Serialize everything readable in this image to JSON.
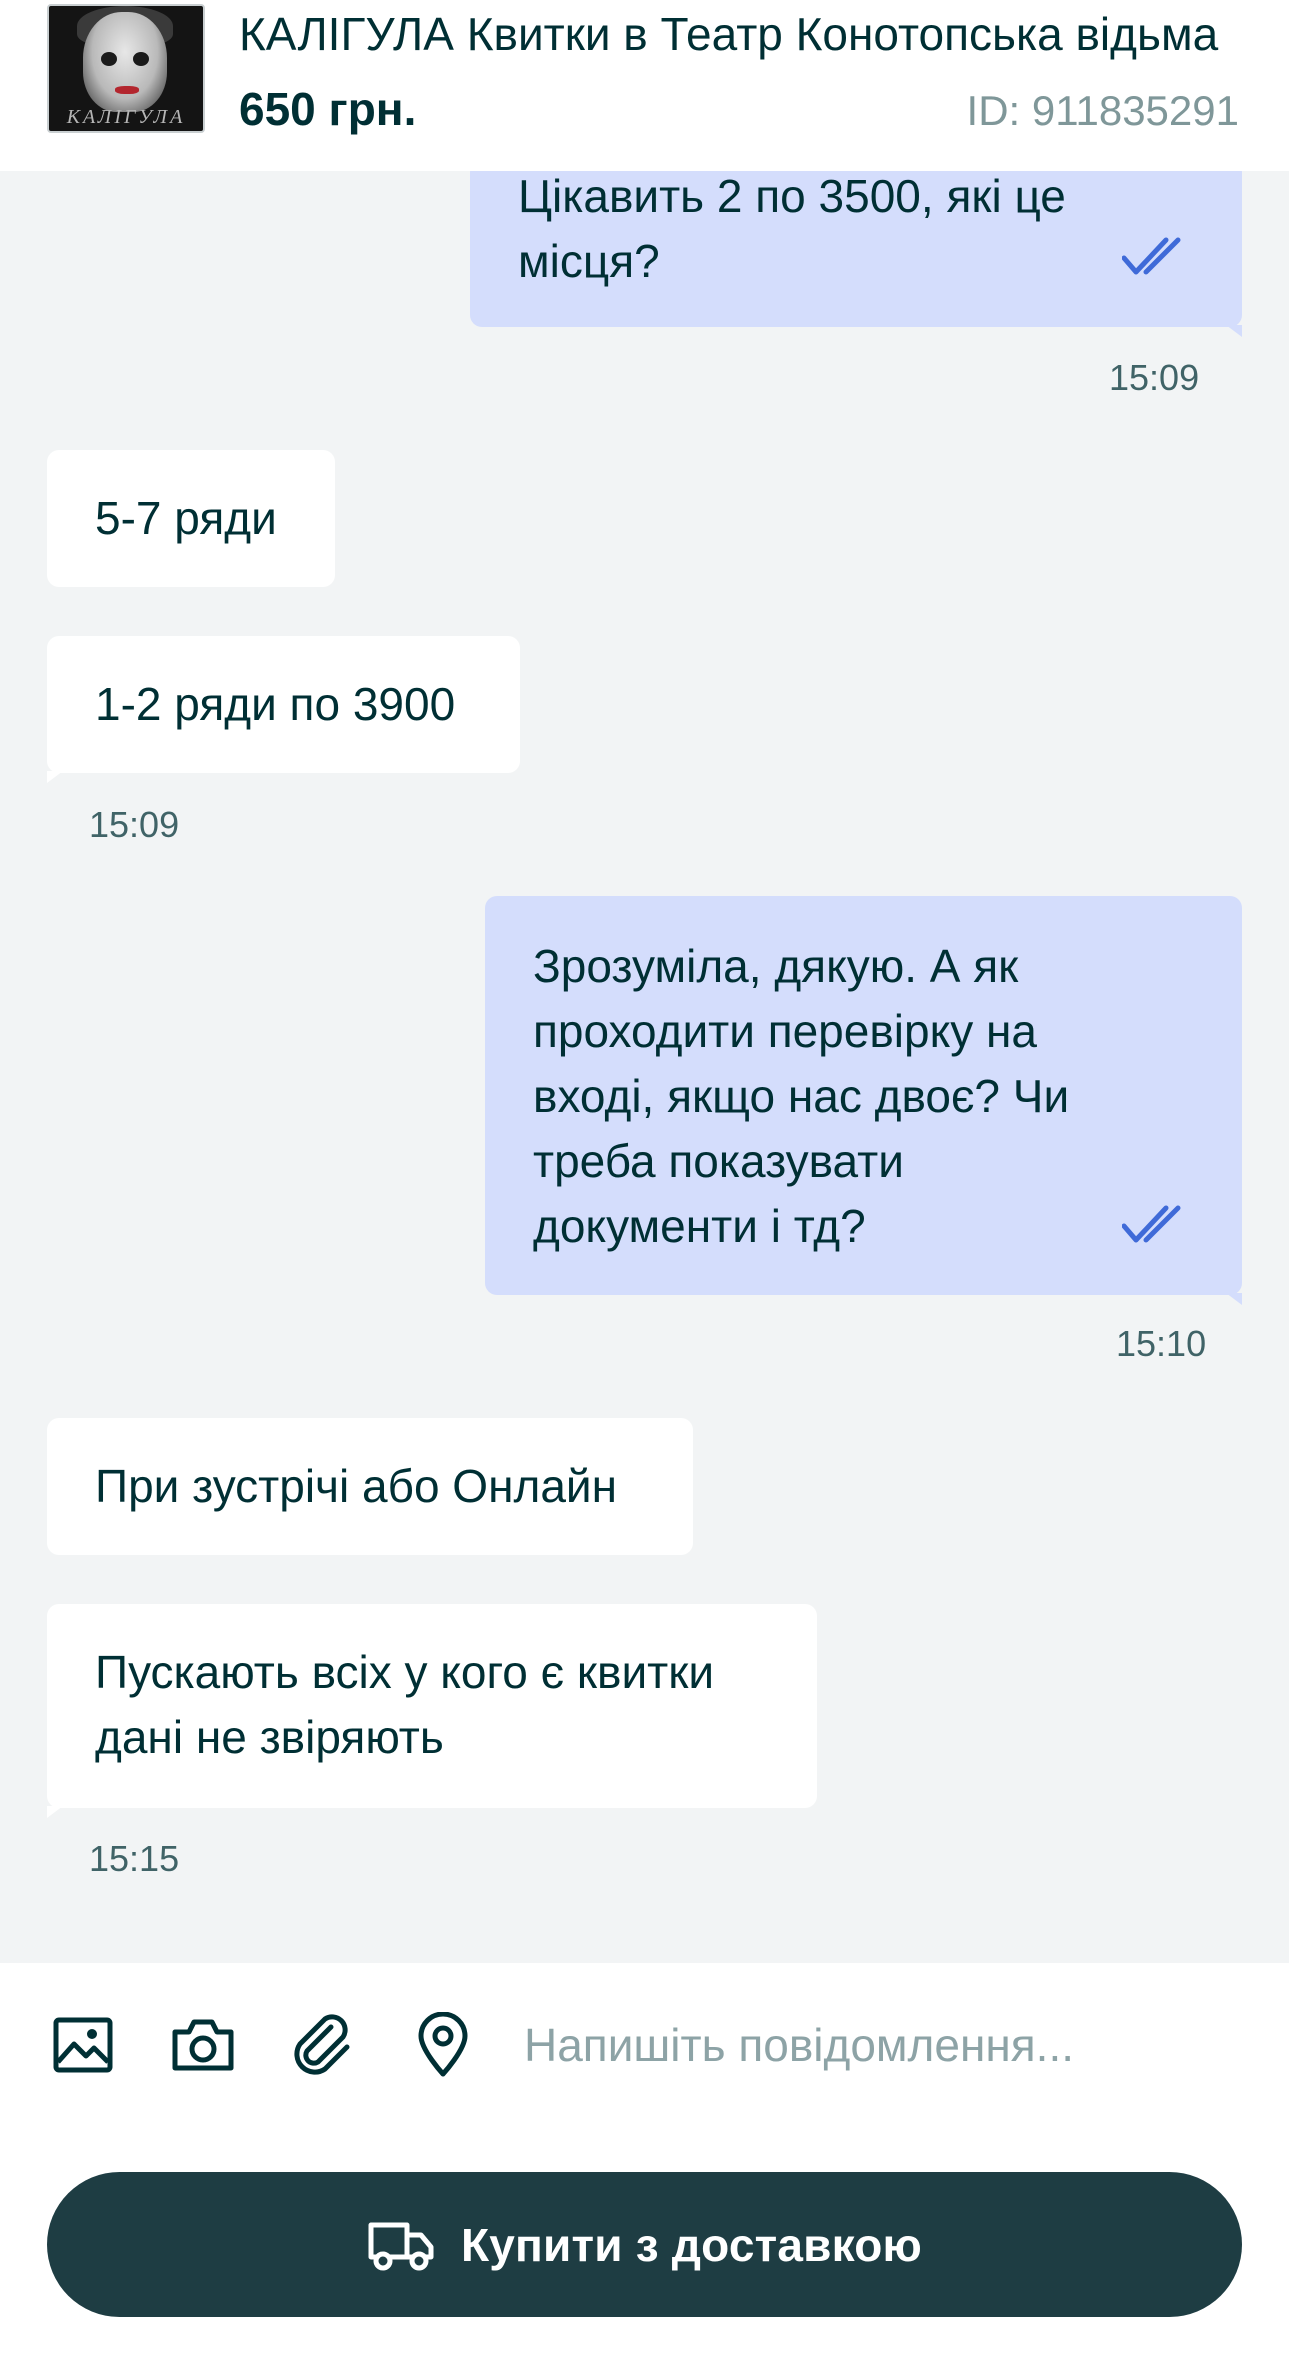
{
  "listing": {
    "title": "КАЛІГУЛА Квитки в Театр Конотопська відьма",
    "price": "650 грн.",
    "id_label": "ID: 911835291",
    "image_logo_text": "КАЛІГУЛА"
  },
  "messages": [
    {
      "direction": "out",
      "text": "Цікавить 2 по 3500, які це місця?",
      "read": true
    },
    {
      "direction": "out_time",
      "text": "15:09"
    },
    {
      "direction": "in",
      "text": "5-7 ряди"
    },
    {
      "direction": "in",
      "text": "1-2 ряди по 3900"
    },
    {
      "direction": "in_time",
      "text": "15:09"
    },
    {
      "direction": "out",
      "text": "Зрозуміла, дякую. А як проходити перевірку на вході, якщо нас двоє? Чи треба показувати документи і тд?",
      "read": true
    },
    {
      "direction": "out_time",
      "text": "15:10"
    },
    {
      "direction": "in",
      "text": "При зустрічі або Онлайн"
    },
    {
      "direction": "in",
      "text": "Пускають всіх у кого є квитки дані не звіряють"
    },
    {
      "direction": "in_time",
      "text": "15:15"
    }
  ],
  "composer": {
    "placeholder": "Напишіть повідомлення...",
    "tools": [
      "image-icon",
      "camera-icon",
      "paperclip-icon",
      "location-pin-icon"
    ]
  },
  "buy_button": {
    "label": "Купити з доставкою",
    "icon": "truck-icon"
  },
  "colors": {
    "primary_dark": "#002f34",
    "button_bg": "#1e3d43",
    "outgoing_bubble": "#d4ddfc",
    "incoming_bubble": "#ffffff",
    "read_check": "#3f6ad8",
    "background": "#f2f4f5"
  }
}
